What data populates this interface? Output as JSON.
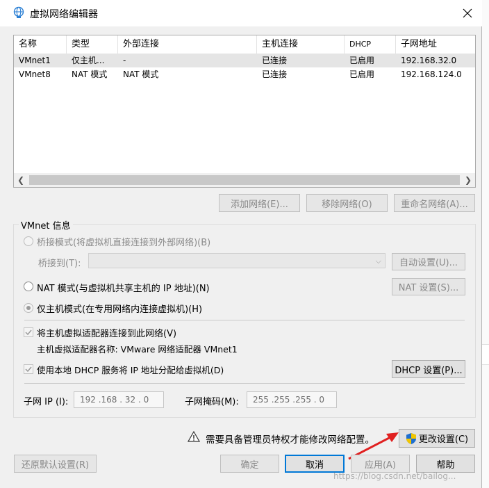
{
  "window": {
    "title": "虚拟网络编辑器",
    "icon": "network-globe-icon",
    "close_icon": "close-icon"
  },
  "table": {
    "columns": [
      "名称",
      "类型",
      "外部连接",
      "主机连接",
      "DHCP",
      "子网地址"
    ],
    "rows": [
      {
        "name": "VMnet1",
        "type": "仅主机...",
        "external": "-",
        "host": "已连接",
        "dhcp": "已启用",
        "subnet": "192.168.32.0"
      },
      {
        "name": "VMnet8",
        "type": "NAT 模式",
        "external": "NAT 模式",
        "host": "已连接",
        "dhcp": "已启用",
        "subnet": "192.168.124.0"
      }
    ]
  },
  "network_buttons": {
    "add": "添加网络(E)...",
    "remove": "移除网络(O)",
    "rename": "重命名网络(A)..."
  },
  "vmnet_info": {
    "label": "VMnet 信息",
    "bridge_mode": "桥接模式(将虚拟机直接连接到外部网络)(B)",
    "bridge_to_label": "桥接到(T):",
    "bridge_to_value": "",
    "auto_settings": "自动设置(U)...",
    "nat_mode": "NAT 模式(与虚拟机共享主机的 IP 地址)(N)",
    "nat_settings": "NAT 设置(S)...",
    "host_only_mode": "仅主机模式(在专用网络内连接虚拟机)(H)",
    "connect_adapter": "将主机虚拟适配器连接到此网络(V)",
    "adapter_name": "主机虚拟适配器名称: VMware 网络适配器 VMnet1",
    "use_dhcp": "使用本地 DHCP 服务将 IP 地址分配给虚拟机(D)",
    "dhcp_settings": "DHCP 设置(P)...",
    "subnet_ip_label": "子网 IP (I):",
    "subnet_ip_value": "192 .168 . 32  .  0",
    "subnet_mask_label": "子网掩码(M):",
    "subnet_mask_value": "255 .255 .255 .  0",
    "selected_mode": "host_only"
  },
  "footer": {
    "warning_text": "需要具备管理员特权才能修改网络配置。",
    "warning_icon": "warning-triangle-icon",
    "change_settings": "更改设置(C)",
    "restore_defaults": "还原默认设置(R)",
    "ok": "确定",
    "cancel": "取消",
    "apply": "应用(A)",
    "help": "帮助"
  },
  "watermark": "https://blog.csdn.net/bailog..."
}
